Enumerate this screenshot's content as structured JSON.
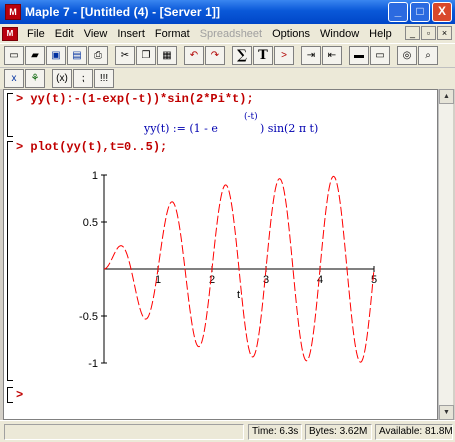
{
  "window": {
    "title": "Maple 7  - [Untitled (4) - [Server 1]]",
    "app_icon_glyph": "M",
    "minimize": "_",
    "maximize": "□",
    "close": "X"
  },
  "menu": {
    "items": [
      "File",
      "Edit",
      "View",
      "Insert",
      "Format",
      "Spreadsheet",
      "Options",
      "Window",
      "Help"
    ],
    "disabled_index": 5,
    "doc_minimize": "_",
    "doc_restore": "▫",
    "doc_close": "×"
  },
  "toolbar1": {
    "buttons": [
      "new-icon",
      "open-icon",
      "save-icon",
      "save-as-icon",
      "print-icon",
      "cut-icon",
      "copy-icon",
      "paste-icon",
      "undo-icon",
      "redo-icon",
      "sum-icon",
      "text-icon",
      "prompt-icon",
      "indent-icon",
      "outdent-icon",
      "collapse-icon",
      "expand-icon",
      "zoom-icon",
      "stop-icon",
      "help-icon"
    ],
    "sigma_label": "∑",
    "t_label": "T",
    "gt_label": ">"
  },
  "toolbar2": {
    "buttons": [
      "exec-icon",
      "exec-all-icon",
      "math-mode-icon",
      "restart-icon",
      "exclaim-icon"
    ],
    "labels": [
      "x",
      "⚘",
      "(x)",
      "⁏",
      "!!!"
    ]
  },
  "worksheet": {
    "input1": "> yy(t):-(1-exp(-t))*sin(2*Pi*t);",
    "output1": "yy(t) := (1 - e",
    "output1_sup": "(-t)",
    "output1_tail": ") sin(2 π t)",
    "input2": "> plot(yy(t),t=0..5);",
    "empty_prompt": ">"
  },
  "chart_data": {
    "type": "line",
    "function": "(1-exp(-t))*sin(2*Pi*t)",
    "xlabel": "t",
    "ylabel": "",
    "xlim": [
      0,
      5
    ],
    "ylim": [
      -1,
      1
    ],
    "x_ticks": [
      "1",
      "2",
      "3",
      "4",
      "5"
    ],
    "y_ticks": [
      "1",
      "0.5",
      "-0.5",
      "-1"
    ],
    "color": "#ff0000",
    "samples": 400
  },
  "status": {
    "time": "Time:  6.3s",
    "bytes": "Bytes: 3.62M",
    "available": "Available: 81.8M"
  }
}
